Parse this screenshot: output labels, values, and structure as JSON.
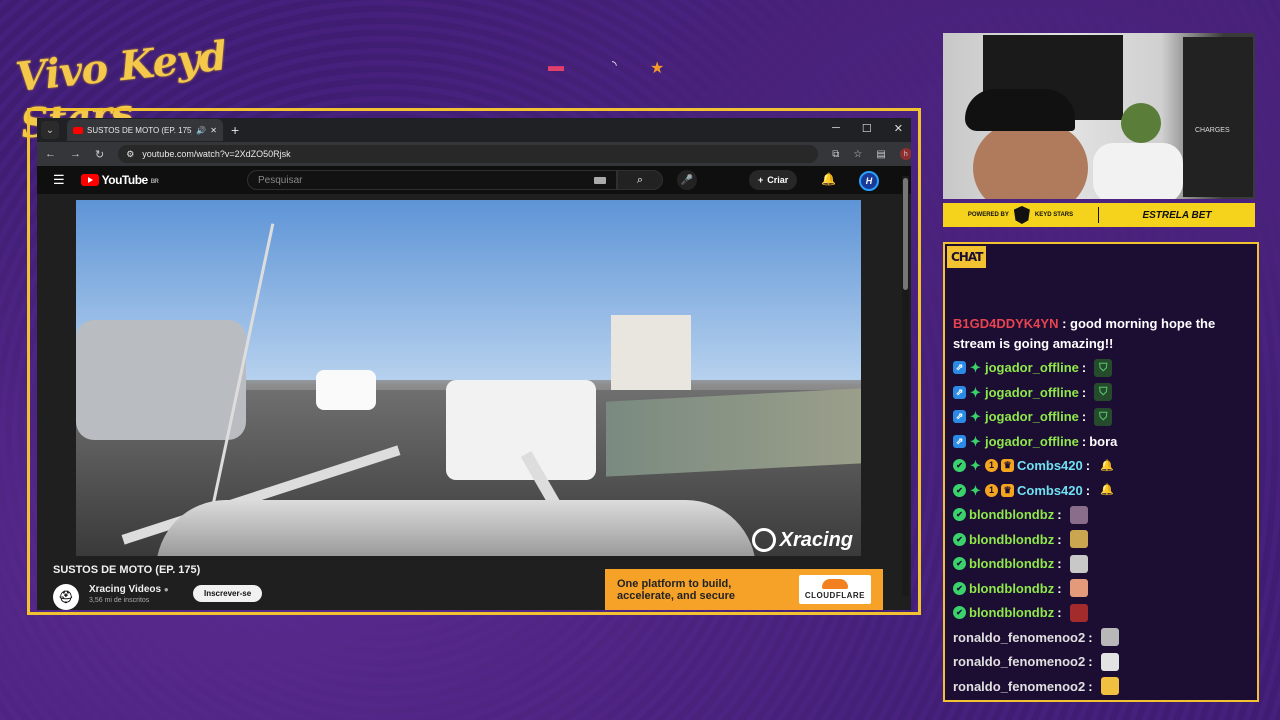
{
  "overlay": {
    "logo_text": "Vivo Keyd Stars"
  },
  "browser": {
    "tab_title": "SUSTOS DE MOTO (EP. 175)",
    "new_tab_glyph": "+",
    "url": "youtube.com/watch?v=2XdZO50Rjsk",
    "profile_initial": "h"
  },
  "youtube": {
    "logo_text": "YouTube",
    "country": "BR",
    "search_placeholder": "Pesquisar",
    "create_label": "Criar",
    "video_watermark": "Xracing",
    "video_title": "SUSTOS DE MOTO (EP. 175)",
    "channel_name": "Xracing Videos",
    "subscribers": "3,56 mi de inscritos",
    "subscribe_label": "Inscrever-se",
    "ad_text": "One platform to build, accelerate, and secure",
    "ad_brand": "CLOUDFLARE"
  },
  "webcam": {
    "poster_text": "CHARGES"
  },
  "sponsor": {
    "powered_by": "POWERED BY",
    "keyd": "KEYD STARS",
    "partner": "ESTRELA BET"
  },
  "chat": {
    "tag": "CHAT",
    "messages": [
      {
        "user": "B1GD4DDYK4YN",
        "text": "good morning hope the stream is going amazing!!",
        "color": "#e8434e"
      },
      {
        "user": "jogador_offline",
        "text": "",
        "color": "#8fe84a",
        "emote": "shield"
      },
      {
        "user": "jogador_offline",
        "text": "",
        "color": "#8fe84a",
        "emote": "shield"
      },
      {
        "user": "jogador_offline",
        "text": "",
        "color": "#8fe84a",
        "emote": "shield"
      },
      {
        "user": "jogador_offline",
        "text": "bora",
        "color": "#8fe84a"
      },
      {
        "user": "Combs420",
        "text": "",
        "color": "#6fe0f0",
        "emote": "bell"
      },
      {
        "user": "Combs420",
        "text": "",
        "color": "#6fe0f0",
        "emote": "bell"
      },
      {
        "user": "blondblondbz",
        "text": "",
        "color": "#8fe84a",
        "emote": "face"
      },
      {
        "user": "blondblondbz",
        "text": "",
        "color": "#8fe84a",
        "emote": "face2"
      },
      {
        "user": "blondblondbz",
        "text": "",
        "color": "#8fe84a",
        "emote": "face3"
      },
      {
        "user": "blondblondbz",
        "text": "",
        "color": "#8fe84a",
        "emote": "face4"
      },
      {
        "user": "blondblondbz",
        "text": "",
        "color": "#8fe84a",
        "emote": "face5"
      },
      {
        "user": "ronaldo_fenomenoo2",
        "text": "",
        "color": "#e0e0e0",
        "emote": "face6"
      },
      {
        "user": "ronaldo_fenomenoo2",
        "text": "",
        "color": "#e0e0e0",
        "emote": "face7"
      },
      {
        "user": "ronaldo_fenomenoo2",
        "text": "",
        "color": "#e0e0e0",
        "emote": "face8"
      }
    ]
  }
}
